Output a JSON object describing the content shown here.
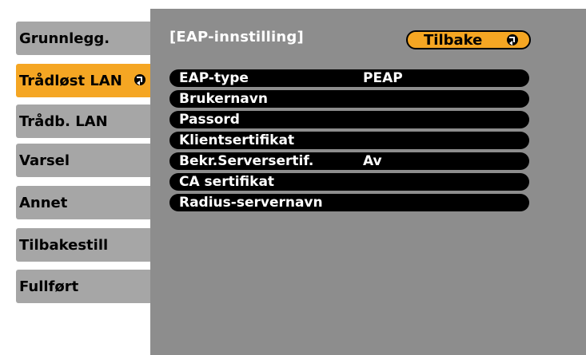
{
  "menu": {
    "items": [
      {
        "label": "Grunnlegg.",
        "selected": false
      },
      {
        "label": "Trådløst LAN",
        "selected": true
      },
      {
        "label": "Trådb. LAN",
        "selected": false
      },
      {
        "label": "Varsel",
        "selected": false
      },
      {
        "label": "Annet",
        "selected": false
      },
      {
        "label": "Tilbakestill",
        "selected": false
      },
      {
        "label": "Fullført",
        "selected": false
      }
    ]
  },
  "panel": {
    "title": "[EAP-innstilling]",
    "back_label": "Tilbake",
    "rows": [
      {
        "label": "EAP-type",
        "value": "PEAP"
      },
      {
        "label": "Brukernavn",
        "value": ""
      },
      {
        "label": "Passord",
        "value": ""
      },
      {
        "label": "Klientsertifikat",
        "value": ""
      },
      {
        "label": "Bekr.Serversertif.",
        "value": "Av"
      },
      {
        "label": "CA sertifikat",
        "value": ""
      },
      {
        "label": "Radius-servernavn",
        "value": ""
      }
    ]
  },
  "colors": {
    "accent": "#f5a623",
    "menu_bg": "#a6a6a6",
    "panel_bg": "#8d8d8d"
  }
}
